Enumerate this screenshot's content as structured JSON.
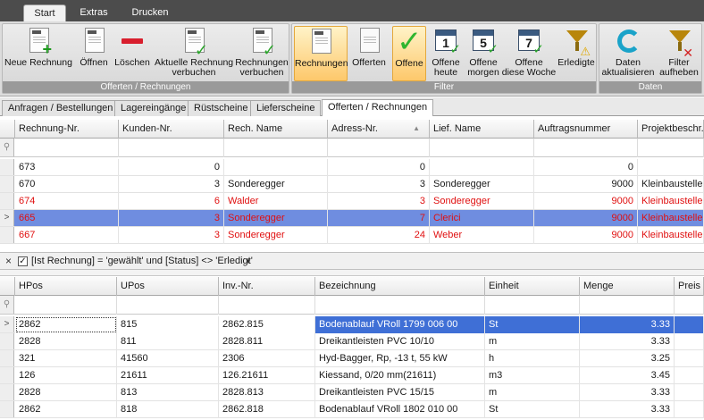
{
  "ribbon_tabs": [
    "Start",
    "Extras",
    "Drucken"
  ],
  "groups": {
    "offerten_rechnungen": {
      "caption": "Offerten / Rechnungen",
      "buttons": [
        {
          "label1": "Neue Rechnung",
          "label2": "",
          "icon": "new-invoice-icon"
        },
        {
          "label1": "Öffnen",
          "label2": "",
          "icon": "open-document-icon"
        },
        {
          "label1": "Löschen",
          "label2": "",
          "icon": "delete-icon"
        },
        {
          "label1": "Aktuelle Rechnung",
          "label2": "verbuchen",
          "icon": "book-invoice-icon"
        },
        {
          "label1": "Rechnungen",
          "label2": "verbuchen",
          "icon": "book-invoices-icon"
        }
      ]
    },
    "filter": {
      "caption": "Filter",
      "buttons": [
        {
          "label1": "Rechnungen",
          "label2": "",
          "icon": "invoices-icon"
        },
        {
          "label1": "Offerten",
          "label2": "",
          "icon": "offers-icon"
        },
        {
          "label1": "Offene",
          "label2": "",
          "icon": "open-check-icon"
        },
        {
          "label1": "Offene",
          "label2": "heute",
          "icon": "calendar-1-icon",
          "cal": "1"
        },
        {
          "label1": "Offene",
          "label2": "morgen",
          "icon": "calendar-5-icon",
          "cal": "5"
        },
        {
          "label1": "Offene",
          "label2": "diese Woche",
          "icon": "calendar-7-icon",
          "cal": "7"
        },
        {
          "label1": "Erledigte",
          "label2": "",
          "icon": "funnel-warning-icon"
        }
      ]
    },
    "daten": {
      "caption": "Daten",
      "buttons": [
        {
          "label1": "Daten",
          "label2": "aktualisieren",
          "icon": "refresh-icon"
        },
        {
          "label1": "Filter",
          "label2": "aufheben",
          "icon": "clear-filter-icon"
        }
      ]
    }
  },
  "doc_tabs": [
    "Anfragen / Bestellungen",
    "Lagereingänge",
    "Rüstscheine",
    "Lieferscheine",
    "Offerten / Rechnungen"
  ],
  "top_grid": {
    "columns": [
      "Rechnung-Nr.",
      "Kunden-Nr.",
      "Rech. Name",
      "Adress-Nr.",
      "Lief. Name",
      "Auftragsnummer",
      "Projektbeschr."
    ],
    "sort_indicator": "▲",
    "rows": [
      [
        "673",
        "0",
        "",
        "0",
        "",
        "0",
        ""
      ],
      [
        "670",
        "3",
        "Sonderegger",
        "3",
        "Sonderegger",
        "9000",
        "Kleinbaustellen"
      ],
      [
        "674",
        "6",
        "Walder",
        "3",
        "Sonderegger",
        "9000",
        "Kleinbaustellen"
      ],
      [
        "665",
        "3",
        "Sonderegger",
        "7",
        "Clerici",
        "9000",
        "Kleinbaustellen"
      ],
      [
        "667",
        "3",
        "Sonderegger",
        "24",
        "Weber",
        "9000",
        "Kleinbaustellen"
      ]
    ]
  },
  "filter_bar": {
    "close": "×",
    "checked": "✓",
    "text": "[Ist Rechnung] = 'gewählt' und [Status] <> 'Erledigt'",
    "dropdown": "▼"
  },
  "bottom_grid": {
    "columns": [
      "HPos",
      "UPos",
      "Inv.-Nr.",
      "Bezeichnung",
      "Einheit",
      "Menge",
      "Preis L"
    ],
    "rows": [
      [
        "2862",
        "815",
        "2862.815",
        "Bodenablauf VRoll 1799 006 00",
        "St",
        "3.33",
        ""
      ],
      [
        "2828",
        "811",
        "2828.811",
        "Dreikantleisten PVC 10/10",
        "m",
        "3.33",
        ""
      ],
      [
        "321",
        "41560",
        "2306",
        "Hyd-Bagger, Rp, -13 t,  55 kW",
        "h",
        "3.25",
        ""
      ],
      [
        "126",
        "21611",
        "126.21611",
        "Kiessand, 0/20 mm(21611)",
        "m3",
        "3.45",
        ""
      ],
      [
        "2828",
        "813",
        "2828.813",
        "Dreikantleisten PVC 15/15",
        "m",
        "3.33",
        ""
      ],
      [
        "2862",
        "818",
        "2862.818",
        "Bodenablauf VRoll 1802 010 00",
        "St",
        "3.33",
        ""
      ]
    ]
  },
  "row_pointer": ">",
  "filter_row_icon": "⚲",
  "colors": {
    "selection": "#6f8de0",
    "red_text": "#e01010",
    "selected_button": "#fdc86b"
  }
}
